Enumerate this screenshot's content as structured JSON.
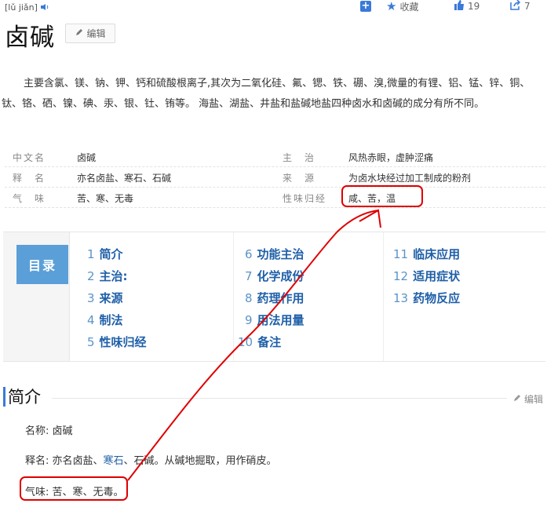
{
  "header": {
    "pinyin": "[lǔ jiǎn]",
    "title": "卤碱",
    "edit_label": "编辑"
  },
  "topbar": {
    "collect_label": "收藏",
    "like_count": "19",
    "share_count": "7"
  },
  "summary": "主要含氯、镁、钠、钾、钙和硫酸根离子,其次为二氧化硅、氟、锶、铁、硼、溴,微量的有锂、铝、锰、锌、铜、钛、铬、硒、镍、碘、汞、银、钍、铕等。 海盐、湖盐、井盐和盐碱地盐四种卤水和卤碱的成分有所不同。",
  "info": [
    {
      "label1": "中文名",
      "value1": "卤碱",
      "label2": "主　治",
      "value2": "风热赤眼，虚肿涩痛"
    },
    {
      "label1": "释　名",
      "value1": "亦名卤盐、寒石、石碱",
      "label2": "来　源",
      "value2": "为卤水块经过加工制成的粉剂"
    },
    {
      "label1": "气　味",
      "value1": "苦、寒、无毒",
      "label2": "性味归经",
      "value2": "咸、苦，温"
    }
  ],
  "toc": {
    "tag": "目录",
    "items": [
      {
        "num": "1",
        "label": "简介"
      },
      {
        "num": "2",
        "label": "主治:"
      },
      {
        "num": "3",
        "label": "来源"
      },
      {
        "num": "4",
        "label": "制法"
      },
      {
        "num": "5",
        "label": "性味归经"
      },
      {
        "num": "6",
        "label": "功能主治"
      },
      {
        "num": "7",
        "label": "化学成份"
      },
      {
        "num": "8",
        "label": "药理作用"
      },
      {
        "num": "9",
        "label": "用法用量"
      },
      {
        "num": "10",
        "label": "备注"
      },
      {
        "num": "11",
        "label": "临床应用"
      },
      {
        "num": "12",
        "label": "适用症状"
      },
      {
        "num": "13",
        "label": "药物反应"
      }
    ]
  },
  "section": {
    "title": "简介",
    "edit_label": "编辑",
    "name_line": "名称: 卤碱",
    "alias_prefix": "释名: 亦名卤盐、",
    "alias_link": "寒石",
    "alias_suffix": "、石碱。从碱地掘取，用作硝皮。",
    "taste_line": "气味: 苦、寒、无毒。"
  },
  "colors": {
    "accent": "#3a7ad8",
    "link": "#1f5fa8",
    "annotation": "#e00000"
  }
}
